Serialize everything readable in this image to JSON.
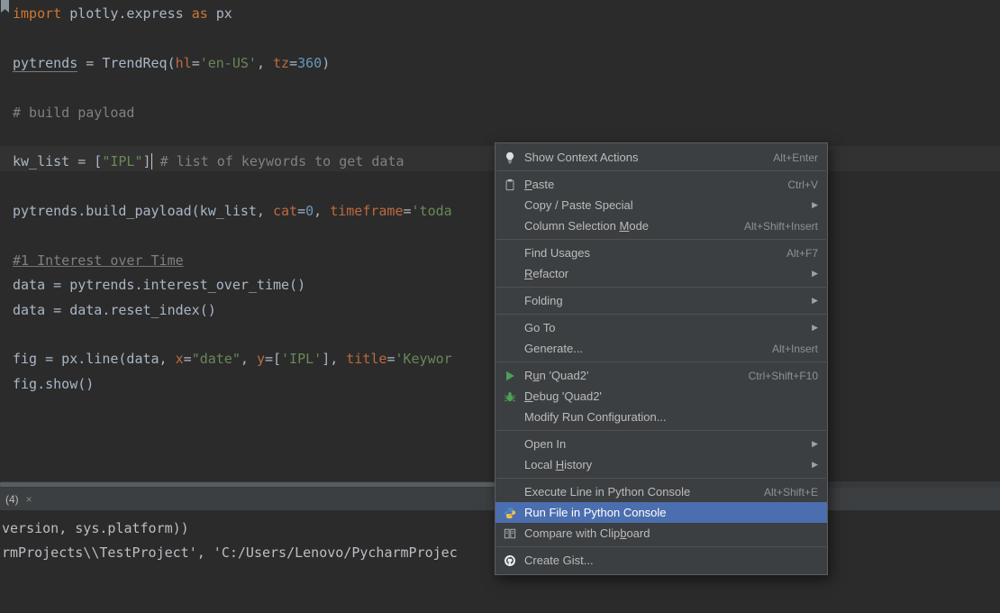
{
  "colors": {
    "editor_bg": "#2b2b2b",
    "menu_bg": "#3c3f41",
    "selection_blue": "#4b6eaf",
    "run_green": "#4da154",
    "keyword_orange": "#cc7832",
    "string_green": "#6a8759"
  },
  "editor": {
    "caret_line_index": 6,
    "lines": [
      [
        [
          "kw",
          "import"
        ],
        [
          "d",
          " plotly.express "
        ],
        [
          "kw",
          "as"
        ],
        [
          "d",
          " px"
        ]
      ],
      [],
      [
        [
          "und",
          "pytrends"
        ],
        [
          "d",
          " = TrendReq("
        ],
        [
          "par",
          "hl"
        ],
        [
          "d",
          "="
        ],
        [
          "str",
          "'en-US'"
        ],
        [
          "d",
          ", "
        ],
        [
          "par",
          "tz"
        ],
        [
          "d",
          "="
        ],
        [
          "num",
          "360"
        ],
        [
          "d",
          ")"
        ]
      ],
      [],
      [
        [
          "com",
          "# build payload"
        ]
      ],
      [],
      [
        [
          "d",
          "kw_list = ["
        ],
        [
          "str",
          "\"IPL\""
        ],
        [
          "d",
          "]"
        ],
        [
          "caret",
          " "
        ],
        [
          "com",
          "# list of keywords to get data"
        ]
      ],
      [],
      [
        [
          "d",
          "pytrends.build_payload(kw_list, "
        ],
        [
          "par",
          "cat"
        ],
        [
          "d",
          "="
        ],
        [
          "num",
          "0"
        ],
        [
          "d",
          ", "
        ],
        [
          "par",
          "timeframe"
        ],
        [
          "d",
          "="
        ],
        [
          "str",
          "'toda"
        ]
      ],
      [],
      [
        [
          "comu",
          "#1 Interest over Time"
        ]
      ],
      [
        [
          "d",
          "data = pytrends.interest_over_time()"
        ]
      ],
      [
        [
          "d",
          "data = data.reset_index()"
        ]
      ],
      [],
      [
        [
          "d",
          "fig = px.line(data, "
        ],
        [
          "par",
          "x"
        ],
        [
          "d",
          "="
        ],
        [
          "str",
          "\"date\""
        ],
        [
          "d",
          ", "
        ],
        [
          "par",
          "y"
        ],
        [
          "d",
          "=["
        ],
        [
          "str",
          "'IPL'"
        ],
        [
          "d",
          "], "
        ],
        [
          "par",
          "title"
        ],
        [
          "d",
          "="
        ],
        [
          "str",
          "'Keywor"
        ]
      ],
      [
        [
          "d",
          "fig.show()"
        ]
      ]
    ]
  },
  "console": {
    "tab_label": "(4)",
    "close_glyph": "×",
    "output_lines": [
      "version, sys.platform))",
      "rmProjects\\\\TestProject', 'C:/Users/Lenovo/PycharmProjec"
    ]
  },
  "menu": {
    "items": [
      {
        "label": "Show Context Actions",
        "shortcut": "Alt+Enter",
        "icon": "lightbulb-icon"
      },
      {
        "type": "separator"
      },
      {
        "label": "Paste",
        "shortcut": "Ctrl+V",
        "icon": "paste-icon",
        "mnemonic": "P"
      },
      {
        "label": "Copy / Paste Special",
        "submenu": true
      },
      {
        "label": "Column Selection Mode",
        "shortcut": "Alt+Shift+Insert",
        "mnemonic": "M"
      },
      {
        "type": "separator"
      },
      {
        "label": "Find Usages",
        "shortcut": "Alt+F7"
      },
      {
        "label": "Refactor",
        "submenu": true,
        "mnemonic": "R"
      },
      {
        "type": "separator"
      },
      {
        "label": "Folding",
        "submenu": true
      },
      {
        "type": "separator"
      },
      {
        "label": "Go To",
        "submenu": true
      },
      {
        "label": "Generate...",
        "shortcut": "Alt+Insert"
      },
      {
        "type": "separator"
      },
      {
        "label": "Run 'Quad2'",
        "shortcut": "Ctrl+Shift+F10",
        "icon": "run-icon",
        "mnemonic": "u"
      },
      {
        "label": "Debug 'Quad2'",
        "icon": "debug-icon",
        "mnemonic": "D"
      },
      {
        "label": "Modify Run Configuration..."
      },
      {
        "type": "separator"
      },
      {
        "label": "Open In",
        "submenu": true
      },
      {
        "label": "Local History",
        "submenu": true,
        "mnemonic": "H"
      },
      {
        "type": "separator"
      },
      {
        "label": "Execute Line in Python Console",
        "shortcut": "Alt+Shift+E"
      },
      {
        "label": "Run File in Python Console",
        "icon": "python-icon",
        "selected": true
      },
      {
        "label": "Compare with Clipboard",
        "icon": "compare-icon",
        "mnemonic": "b"
      },
      {
        "type": "separator"
      },
      {
        "label": "Create Gist...",
        "icon": "github-icon"
      }
    ]
  }
}
